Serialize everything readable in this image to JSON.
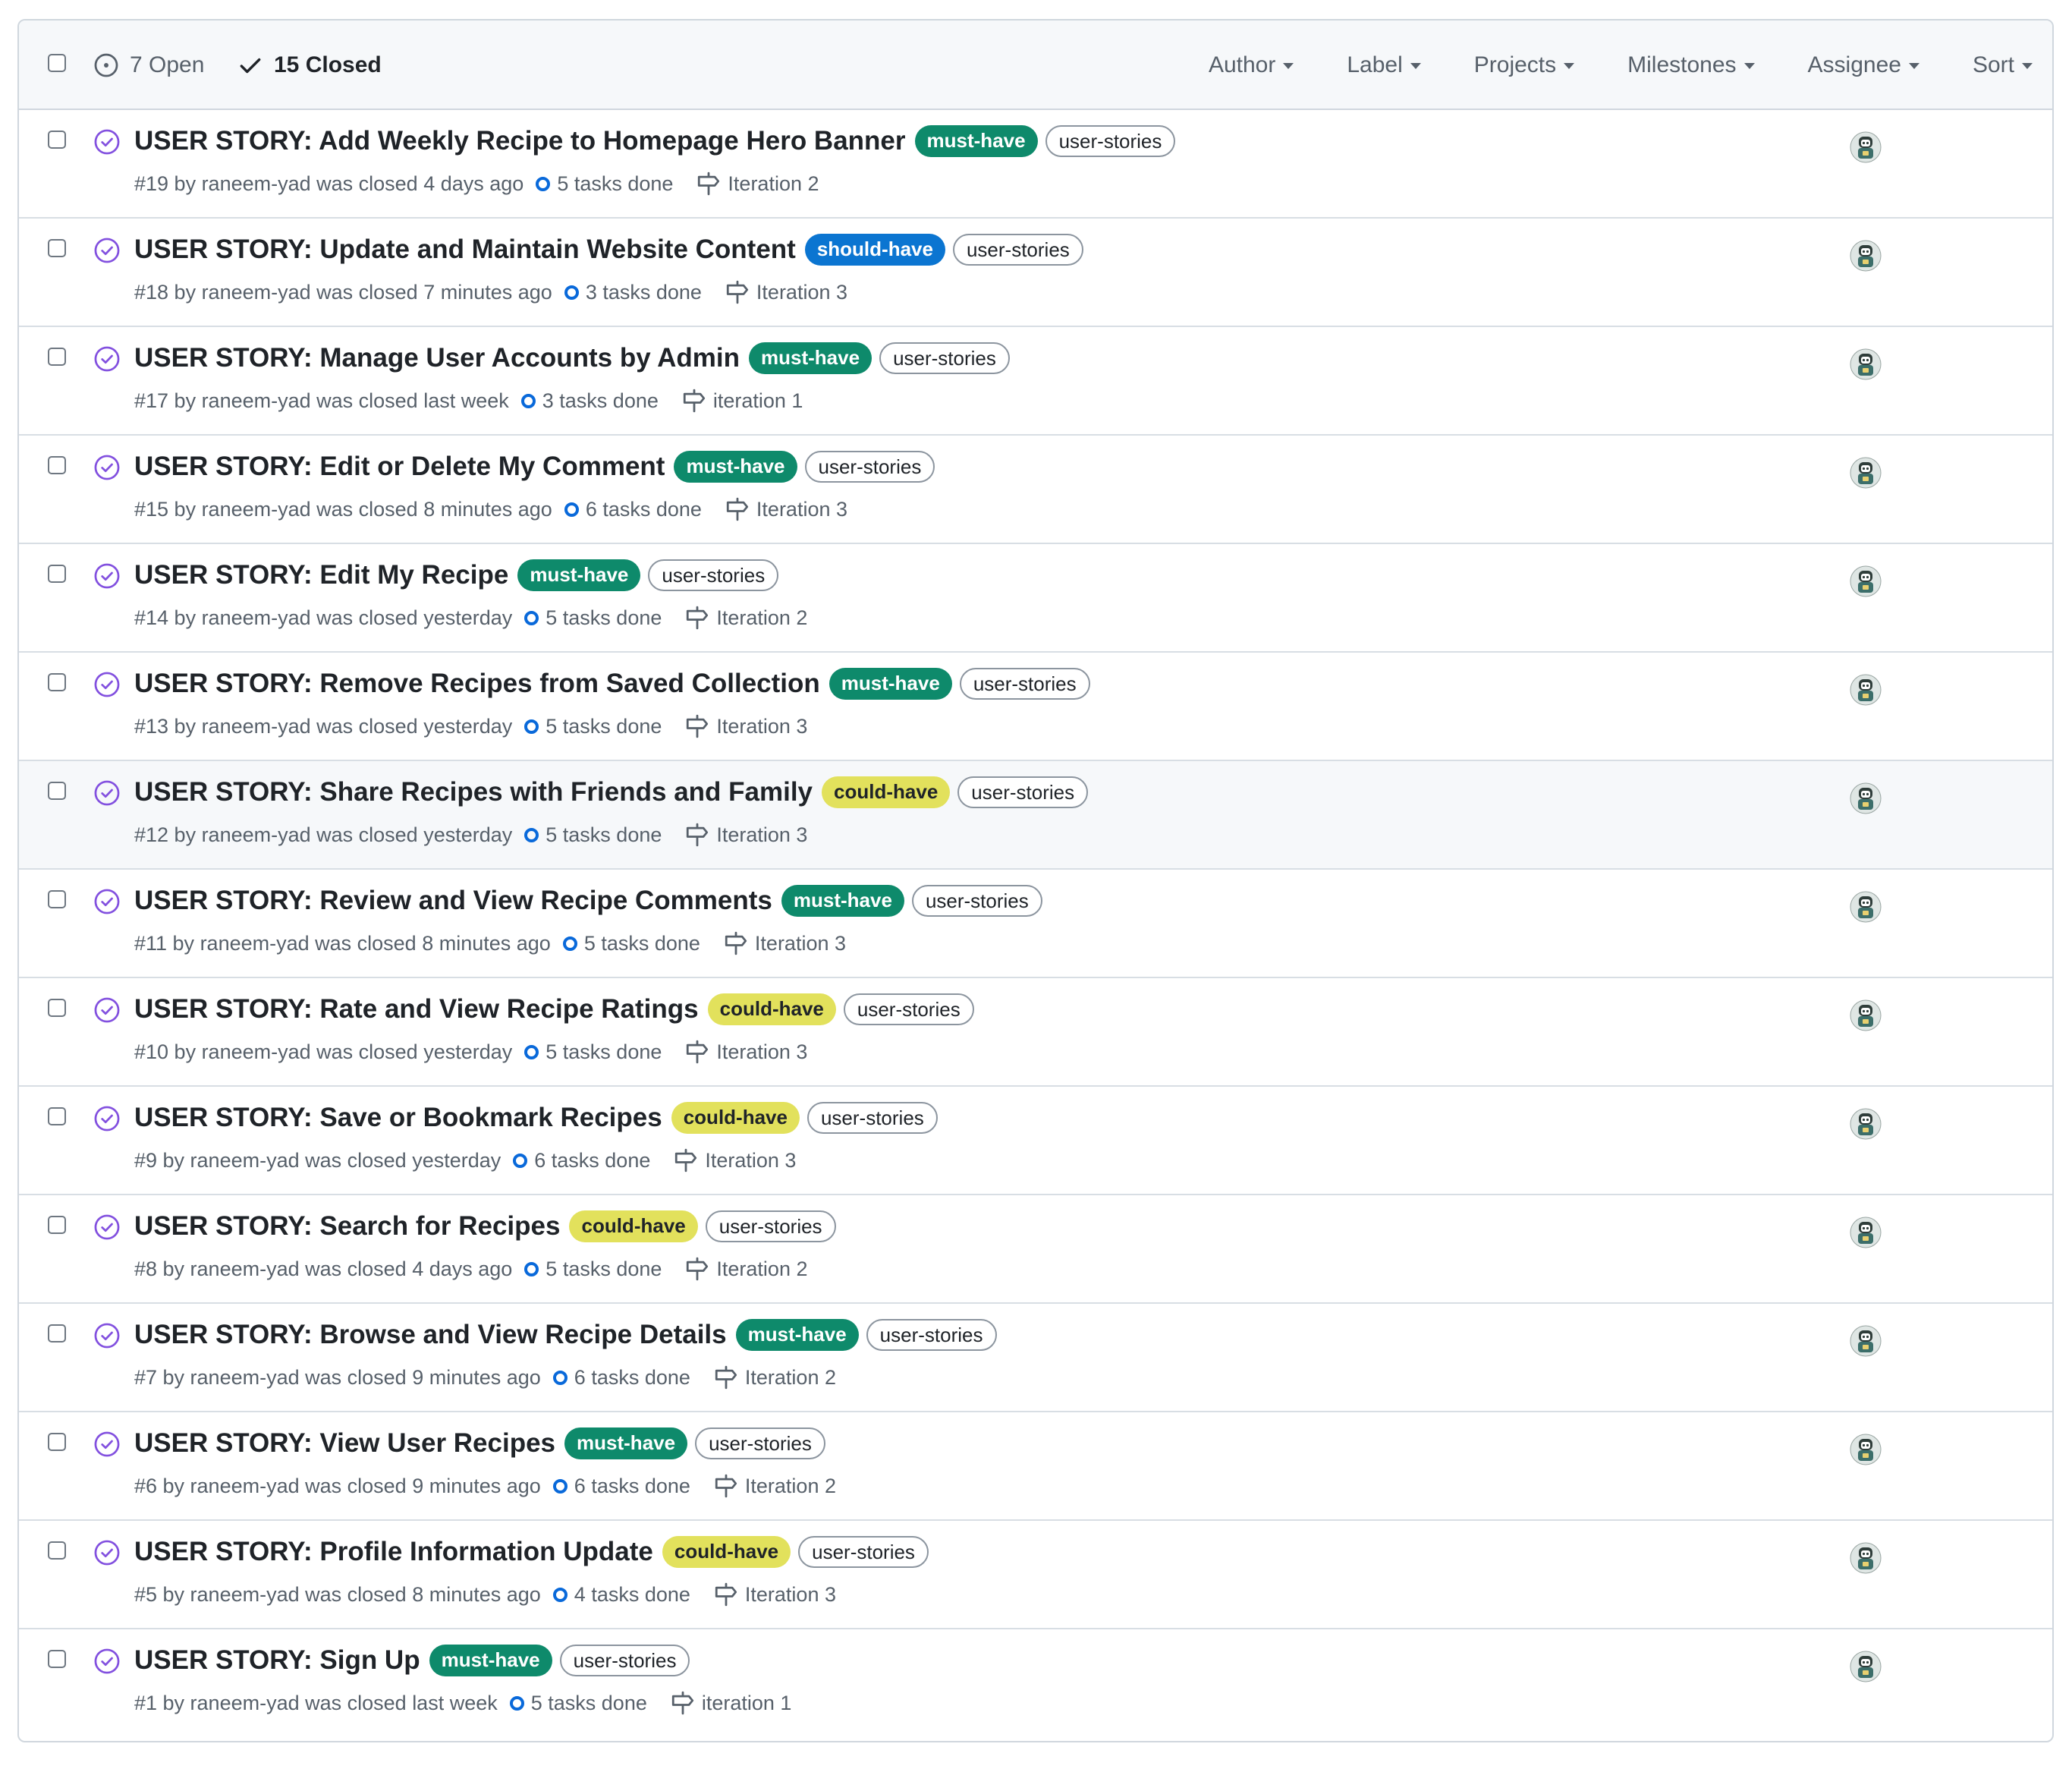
{
  "header": {
    "open_label": "7 Open",
    "closed_label": "15 Closed",
    "filters": [
      "Author",
      "Label",
      "Projects",
      "Milestones",
      "Assignee",
      "Sort"
    ]
  },
  "colors": {
    "must_have": "#0e8a6b",
    "should_have": "#0b75d1",
    "could_have": "#e2e15c",
    "closed_purple": "#8250df",
    "task_blue": "#0969da"
  },
  "issues": [
    {
      "title": "USER STORY: Add Weekly Recipe to Homepage Hero Banner",
      "priority": "must-have",
      "type_label": "user-stories",
      "meta": "#19 by raneem-yad was closed 4 days ago",
      "tasks": "5 tasks done",
      "milestone": "Iteration 2"
    },
    {
      "title": "USER STORY: Update and Maintain Website Content",
      "priority": "should-have",
      "type_label": "user-stories",
      "meta": "#18 by raneem-yad was closed 7 minutes ago",
      "tasks": "3 tasks done",
      "milestone": "Iteration 3"
    },
    {
      "title": "USER STORY: Manage User Accounts by Admin",
      "priority": "must-have",
      "type_label": "user-stories",
      "meta": "#17 by raneem-yad was closed last week",
      "tasks": "3 tasks done",
      "milestone": "iteration 1"
    },
    {
      "title": "USER STORY: Edit or Delete My Comment",
      "priority": "must-have",
      "type_label": "user-stories",
      "meta": "#15 by raneem-yad was closed 8 minutes ago",
      "tasks": "6 tasks done",
      "milestone": "Iteration 3"
    },
    {
      "title": "USER STORY: Edit My Recipe",
      "priority": "must-have",
      "type_label": "user-stories",
      "meta": "#14 by raneem-yad was closed yesterday",
      "tasks": "5 tasks done",
      "milestone": "Iteration 2"
    },
    {
      "title": "USER STORY: Remove Recipes from Saved Collection",
      "priority": "must-have",
      "type_label": "user-stories",
      "meta": "#13 by raneem-yad was closed yesterday",
      "tasks": "5 tasks done",
      "milestone": "Iteration 3"
    },
    {
      "title": "USER STORY: Share Recipes with Friends and Family",
      "priority": "could-have",
      "type_label": "user-stories",
      "meta": "#12 by raneem-yad was closed yesterday",
      "tasks": "5 tasks done",
      "milestone": "Iteration 3",
      "hover": true
    },
    {
      "title": "USER STORY: Review and View Recipe Comments",
      "priority": "must-have",
      "type_label": "user-stories",
      "meta": "#11 by raneem-yad was closed 8 minutes ago",
      "tasks": "5 tasks done",
      "milestone": "Iteration 3"
    },
    {
      "title": "USER STORY: Rate and View Recipe Ratings",
      "priority": "could-have",
      "type_label": "user-stories",
      "meta": "#10 by raneem-yad was closed yesterday",
      "tasks": "5 tasks done",
      "milestone": "Iteration 3"
    },
    {
      "title": "USER STORY: Save or Bookmark Recipes",
      "priority": "could-have",
      "type_label": "user-stories",
      "meta": "#9 by raneem-yad was closed yesterday",
      "tasks": "6 tasks done",
      "milestone": "Iteration 3"
    },
    {
      "title": "USER STORY: Search for Recipes",
      "priority": "could-have",
      "type_label": "user-stories",
      "meta": "#8 by raneem-yad was closed 4 days ago",
      "tasks": "5 tasks done",
      "milestone": "Iteration 2"
    },
    {
      "title": "USER STORY: Browse and View Recipe Details",
      "priority": "must-have",
      "type_label": "user-stories",
      "meta": "#7 by raneem-yad was closed 9 minutes ago",
      "tasks": "6 tasks done",
      "milestone": "Iteration 2"
    },
    {
      "title": "USER STORY: View User Recipes",
      "priority": "must-have",
      "type_label": "user-stories",
      "meta": "#6 by raneem-yad was closed 9 minutes ago",
      "tasks": "6 tasks done",
      "milestone": "Iteration 2"
    },
    {
      "title": "USER STORY: Profile Information Update",
      "priority": "could-have",
      "type_label": "user-stories",
      "meta": "#5 by raneem-yad was closed 8 minutes ago",
      "tasks": "4 tasks done",
      "milestone": "Iteration 3"
    },
    {
      "title": "USER STORY: Sign Up",
      "priority": "must-have",
      "type_label": "user-stories",
      "meta": "#1 by raneem-yad was closed last week",
      "tasks": "5 tasks done",
      "milestone": "iteration 1"
    }
  ]
}
